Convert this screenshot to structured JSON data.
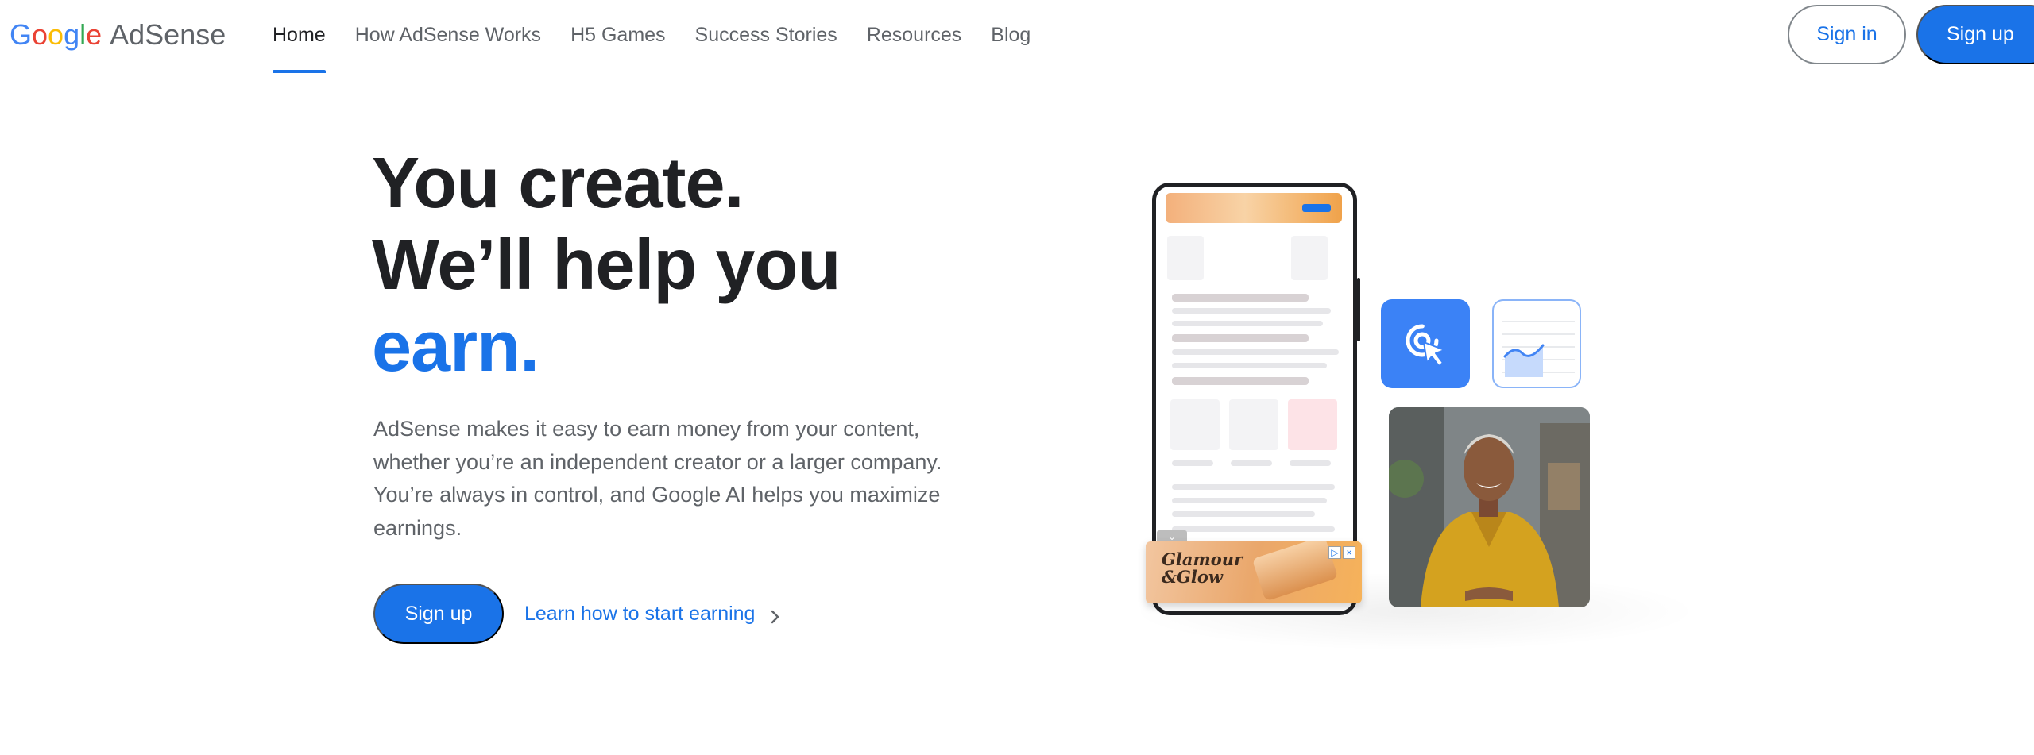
{
  "header": {
    "logo": {
      "google_letters": [
        "G",
        "o",
        "o",
        "g",
        "l",
        "e"
      ],
      "product": "AdSense"
    },
    "nav": [
      {
        "label": "Home",
        "active": true
      },
      {
        "label": "How AdSense Works",
        "active": false
      },
      {
        "label": "H5 Games",
        "active": false
      },
      {
        "label": "Success Stories",
        "active": false
      },
      {
        "label": "Resources",
        "active": false
      },
      {
        "label": "Blog",
        "active": false
      }
    ],
    "sign_in": "Sign in",
    "sign_up": "Sign up"
  },
  "hero": {
    "headline_line1": "You create.",
    "headline_line2": "We’ll help you",
    "headline_line3": "earn.",
    "description": "AdSense makes it easy to earn money from your content, whether you’re an independent creator or a larger company. You’re always in control, and Google AI helps you maximize earnings.",
    "sign_up": "Sign up",
    "learn_link": "Learn how to start earning"
  },
  "illustration": {
    "ad_brand_line1": "Glamour",
    "ad_brand_line2": "&Glow"
  },
  "colors": {
    "accent": "#1a73e8",
    "google_blue": "#4285f4",
    "google_red": "#ea4335",
    "google_yellow": "#fbbc05",
    "google_green": "#34a853"
  },
  "icons": [
    "chevron-right-icon",
    "click-cursor-icon",
    "line-chart-icon",
    "ad-choices-icon",
    "close-icon"
  ]
}
